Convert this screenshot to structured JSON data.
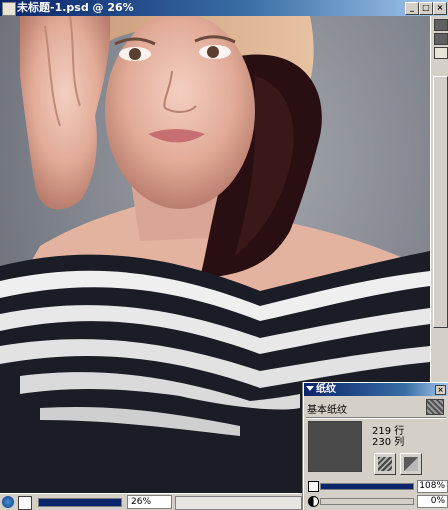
{
  "window": {
    "title": "未标题-1.psd @ 26%",
    "minimize_glyph": "_",
    "maximize_glyph": "□",
    "close_glyph": "×"
  },
  "status_bar": {
    "zoom_value": "26%"
  },
  "texture_panel": {
    "title": "纸纹",
    "close_glyph": "×",
    "selected_texture": "基本纸纹",
    "rows": "219 行",
    "columns": "230 列",
    "scale_value": "108%",
    "contrast_value": "0%",
    "icons": {
      "texture_swatch": "texture-swatch-icon",
      "invert": "invert-texture-icon",
      "flip": "flip-texture-icon",
      "scale": "scale-icon",
      "contrast": "contrast-icon"
    }
  },
  "colors": {
    "title_bar": "#0a246a",
    "chrome": "#d4d0c8",
    "background_gray": "#7b7f87"
  }
}
